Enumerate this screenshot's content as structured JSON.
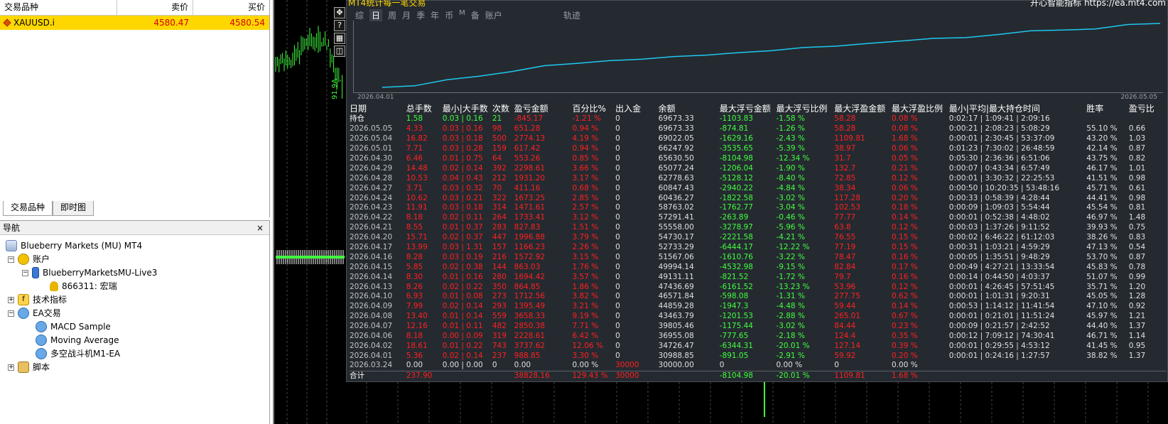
{
  "market_watch": {
    "headers": {
      "symbol": "交易品种",
      "bid": "卖价",
      "ask": "买价"
    },
    "rows": [
      {
        "symbol": "XAUUSD.i",
        "bid": "4580.47",
        "ask": "4580.54"
      }
    ],
    "tabs": [
      "交易品种",
      "即时图"
    ]
  },
  "navigator": {
    "title": "导航",
    "close": "×",
    "items": [
      {
        "label": "Blueberry Markets (MU) MT4"
      },
      {
        "label": "账户"
      },
      {
        "label": "BlueberryMarketsMU-Live3"
      },
      {
        "label": "866311: 宏瑞"
      },
      {
        "label": "技术指标"
      },
      {
        "label": "EA交易"
      },
      {
        "label": "MACD Sample"
      },
      {
        "label": "Moving Average"
      },
      {
        "label": "多空战斗机M1-EA"
      },
      {
        "label": "脚本"
      }
    ]
  },
  "chart": {
    "price_label": "91.9A",
    "toolbar_icons": [
      "move-icon",
      "help-icon",
      "grid-icon",
      "window-icon"
    ]
  },
  "stats": {
    "title_fragment": "MT4统计每一笔交易",
    "top_right_fragment": "开心智能指标 https://ea.mt4.com",
    "tabs": [
      "综",
      "日",
      "周",
      "月",
      "季",
      "年",
      "币",
      "M",
      "备",
      "账户"
    ],
    "active_tab": "日",
    "track_label": "轨迹",
    "eq_date_start": "2026.04.01",
    "eq_date_end": "2026.05.05",
    "line_color": "#1ec8f0",
    "columns": [
      "日期",
      "总手数",
      "最小|大手数",
      "次数",
      "盈亏金额",
      "百分比%",
      "出入金",
      "余额",
      "最大浮亏金额",
      "最大浮亏比例",
      "最大浮盈金额",
      "最大浮盈比例",
      "最小|平均|最大持仓时间",
      "胜率",
      "盈亏比"
    ],
    "rows": [
      [
        "持仓",
        "1.58",
        "0.03 | 0.16",
        "21",
        "-845.17",
        "-1.21 %",
        "0",
        "69673.33",
        "-1103.83",
        "-1.58 %",
        "58.28",
        "0.08 %",
        "0:02:17 | 1:09:41 | 2:09:16",
        "",
        ""
      ],
      [
        "2026.05.05",
        "4.33",
        "0.03 | 0.16",
        "98",
        "651.28",
        "0.94 %",
        "0",
        "69673.33",
        "-874.81",
        "-1.26 %",
        "58.28",
        "0.08 %",
        "0:00:21 | 2:08:23 | 5:08:29",
        "55.10 %",
        "0.66"
      ],
      [
        "2026.05.04",
        "16.82",
        "0.03 | 0.18",
        "500",
        "2774.13",
        "4.19 %",
        "0",
        "69022.05",
        "-1629.16",
        "-2.43 %",
        "1109.81",
        "1.68 %",
        "0:00:01 | 2:30:45 | 53:37:09",
        "43.20 %",
        "1.03"
      ],
      [
        "2026.05.01",
        "7.71",
        "0.03 | 0.28",
        "159",
        "617.42",
        "0.94 %",
        "0",
        "66247.92",
        "-3535.65",
        "-5.39 %",
        "38.97",
        "0.06 %",
        "0:01:23 | 7:30:02 | 26:48:59",
        "42.14 %",
        "0.87"
      ],
      [
        "2026.04.30",
        "6.46",
        "0.01 | 0.75",
        "64",
        "553.26",
        "0.85 %",
        "0",
        "65630.50",
        "-8104.98",
        "-12.34 %",
        "31.7",
        "0.05 %",
        "0:05:30 | 2:36:36 | 6:51:06",
        "43.75 %",
        "0.82"
      ],
      [
        "2026.04.29",
        "14.48",
        "0.02 | 0.14",
        "392",
        "2298.61",
        "3.66 %",
        "0",
        "65077.24",
        "-1206.04",
        "-1.90 %",
        "132.7",
        "0.21 %",
        "0:00:07 | 0:43:34 | 6:57:49",
        "46.17 %",
        "1.01"
      ],
      [
        "2026.04.28",
        "10.53",
        "0.04 | 0.43",
        "212",
        "1931.20",
        "3.17 %",
        "0",
        "62778.63",
        "-5128.12",
        "-8.40 %",
        "72.85",
        "0.12 %",
        "0:00:01 | 3:30:32 | 22:25:53",
        "41.51 %",
        "0.98"
      ],
      [
        "2026.04.27",
        "3.71",
        "0.03 | 0.32",
        "70",
        "411.16",
        "0.68 %",
        "0",
        "60847.43",
        "-2940.22",
        "-4.84 %",
        "38.34",
        "0.06 %",
        "0:00:50 | 10:20:35 | 53:48:16",
        "45.71 %",
        "0.61"
      ],
      [
        "2026.04.24",
        "10.62",
        "0.03 | 0.21",
        "322",
        "1673.25",
        "2.85 %",
        "0",
        "60436.27",
        "-1822.58",
        "-3.02 %",
        "117.28",
        "0.20 %",
        "0:00:33 | 0:58:39 | 4:28:44",
        "44.41 %",
        "0.98"
      ],
      [
        "2026.04.23",
        "11.91",
        "0.03 | 0.18",
        "314",
        "1471.61",
        "2.57 %",
        "0",
        "58763.02",
        "-1762.77",
        "-3.04 %",
        "102.53",
        "0.18 %",
        "0:00:09 | 1:09:03 | 5:54:44",
        "45.54 %",
        "0.81"
      ],
      [
        "2026.04.22",
        "8.18",
        "0.02 | 0.11",
        "264",
        "1733.41",
        "3.12 %",
        "0",
        "57291.41",
        "-263.89",
        "-0.46 %",
        "77.77",
        "0.14 %",
        "0:00:01 | 0:52:38 | 4:48:02",
        "46.97 %",
        "1.48"
      ],
      [
        "2026.04.21",
        "8.55",
        "0.01 | 0.37",
        "283",
        "827.83",
        "1.51 %",
        "0",
        "55558.00",
        "-3278.97",
        "-5.96 %",
        "63.8",
        "0.12 %",
        "0:00:03 | 1:37:26 | 9:11:52",
        "39.93 %",
        "0.75"
      ],
      [
        "2026.04.20",
        "15.71",
        "0.02 | 0.37",
        "447",
        "1996.88",
        "3.79 %",
        "0",
        "54730.17",
        "-2221.58",
        "-4.21 %",
        "76.55",
        "0.15 %",
        "0:00:02 | 6:46:22 | 61:12:03",
        "38.26 %",
        "0.83"
      ],
      [
        "2026.04.17",
        "13.99",
        "0.03 | 1.31",
        "157",
        "1166.23",
        "2.26 %",
        "0",
        "52733.29",
        "-6444.17",
        "-12.22 %",
        "77.19",
        "0.15 %",
        "0:00:31 | 1:03:21 | 4:59:29",
        "47.13 %",
        "0.54"
      ],
      [
        "2026.04.16",
        "8.28",
        "0.03 | 0.19",
        "216",
        "1572.92",
        "3.15 %",
        "0",
        "51567.06",
        "-1610.76",
        "-3.22 %",
        "78.47",
        "0.16 %",
        "0:00:05 | 1:35:51 | 9:48:29",
        "53.70 %",
        "0.87"
      ],
      [
        "2026.04.15",
        "5.85",
        "0.02 | 0.38",
        "144",
        "863.03",
        "1.76 %",
        "0",
        "49994.14",
        "-4532.98",
        "-9.15 %",
        "82.84",
        "0.17 %",
        "0:00:49 | 4:27:21 | 13:33:54",
        "45.83 %",
        "0.78"
      ],
      [
        "2026.04.14",
        "8.30",
        "0.01 | 0.16",
        "280",
        "1694.42",
        "3.57 %",
        "0",
        "49131.11",
        "-821.52",
        "-1.72 %",
        "79.7",
        "0.16 %",
        "0:00:14 | 0:44:50 | 4:03:37",
        "51.07 %",
        "0.99"
      ],
      [
        "2026.04.13",
        "8.26",
        "0.02 | 0.22",
        "350",
        "864.85",
        "1.86 %",
        "0",
        "47436.69",
        "-6161.52",
        "-13.23 %",
        "53.96",
        "0.12 %",
        "0:00:01 | 4:26:45 | 57:51:45",
        "35.71 %",
        "1.20"
      ],
      [
        "2026.04.10",
        "6.93",
        "0.01 | 0.08",
        "273",
        "1712.56",
        "3.82 %",
        "0",
        "46571.84",
        "-598.08",
        "-1.31 %",
        "277.75",
        "0.62 %",
        "0:00:01 | 1:01:31 | 9:20:31",
        "45.05 %",
        "1.28"
      ],
      [
        "2026.04.09",
        "7.99",
        "0.02 | 0.14",
        "293",
        "1395.49",
        "3.21 %",
        "0",
        "44859.28",
        "-1947.3",
        "-4.48 %",
        "59.44",
        "0.14 %",
        "0:00:53 | 1:14:12 | 11:41:54",
        "47.10 %",
        "0.92"
      ],
      [
        "2026.04.08",
        "13.40",
        "0.01 | 0.14",
        "559",
        "3658.33",
        "9.19 %",
        "0",
        "43463.79",
        "-1201.53",
        "-2.88 %",
        "265.01",
        "0.67 %",
        "0:00:01 | 0:21:01 | 11:51:24",
        "45.97 %",
        "1.21"
      ],
      [
        "2026.04.07",
        "12.16",
        "0.01 | 0.11",
        "482",
        "2850.38",
        "7.71 %",
        "0",
        "39805.46",
        "-1175.44",
        "-3.02 %",
        "84.44",
        "0.23 %",
        "0:00:09 | 0:21:57 | 2:42:52",
        "44.40 %",
        "1.37"
      ],
      [
        "2026.04.06",
        "8.18",
        "0.00 | 0.09",
        "319",
        "2228.61",
        "6.42 %",
        "0",
        "36955.08",
        "-777.65",
        "-2.18 %",
        "124.4",
        "0.35 %",
        "0:00:12 | 7:09:12 | 74:30:41",
        "46.71 %",
        "1.14"
      ],
      [
        "2026.04.02",
        "18.61",
        "0.01 | 0.22",
        "743",
        "3737.62",
        "12.06 %",
        "0",
        "34726.47",
        "-6344.31",
        "-20.01 %",
        "127.14",
        "0.39 %",
        "0:00:01 | 0:29:55 | 4:53:12",
        "41.45 %",
        "0.95"
      ],
      [
        "2026.04.01",
        "5.36",
        "0.02 | 0.14",
        "237",
        "988.85",
        "3.30 %",
        "0",
        "30988.85",
        "-891.05",
        "-2.91 %",
        "59.92",
        "0.20 %",
        "0:00:01 | 0:24:16 | 1:27:57",
        "38.82 %",
        "1.37"
      ],
      [
        "2026.03.24",
        "0.00",
        "0.00 | 0.00",
        "0",
        "0.00",
        "0.00 %",
        "30000",
        "30000.00",
        "0",
        "0.00 %",
        "0",
        "0.00 %",
        "",
        "",
        ""
      ]
    ],
    "total": [
      "合计",
      "237.90",
      "",
      "",
      "38828.16",
      "129.43 %",
      "30000",
      "",
      "-8104.98",
      "-20.01 %",
      "1109.81",
      "1.68 %",
      "",
      "",
      ""
    ]
  }
}
